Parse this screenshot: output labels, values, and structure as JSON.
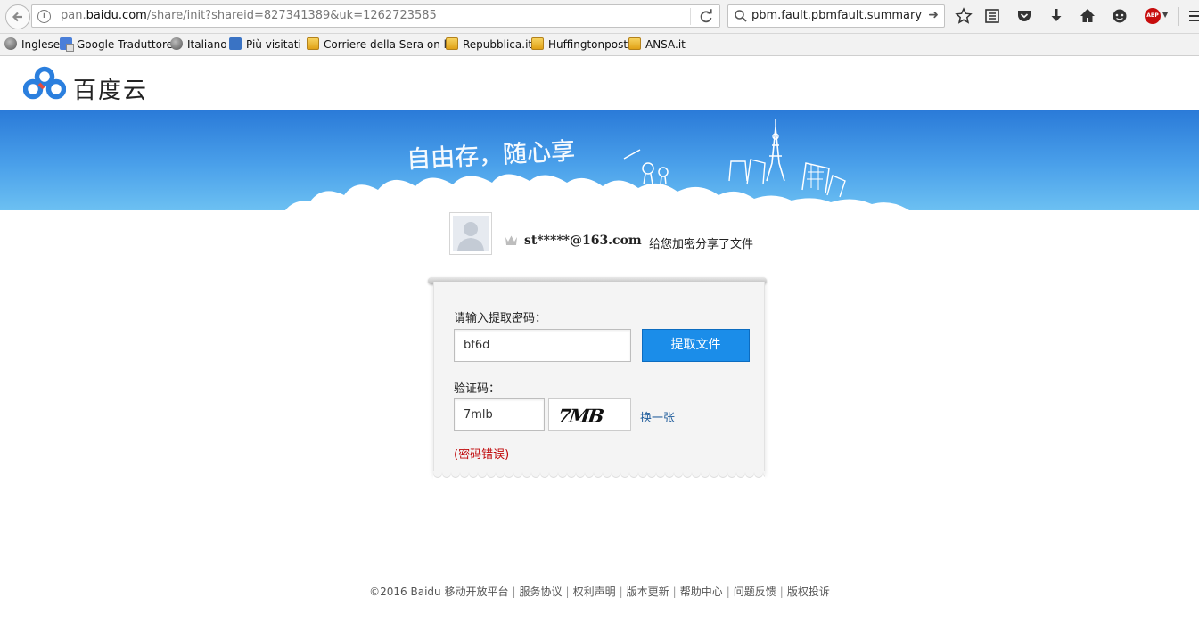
{
  "browser": {
    "url_prefix": "pan.",
    "url_domain": "baidu.com",
    "url_path": "/share/init?shareid=827341389&uk=1262723585",
    "search_text": "pbm.fault.pbmfault.summary",
    "addon_label": "ABP"
  },
  "bookmarks": [
    {
      "label": "Inglese",
      "icon": "globe-icon"
    },
    {
      "label": "Google Traduttore",
      "icon": "google-translate-icon"
    },
    {
      "label": "Italiano",
      "icon": "globe-icon"
    },
    {
      "label": "Più visitati",
      "icon": "most-visited-icon"
    },
    {
      "label": "Corriere della Sera on l...",
      "icon": "rss-feed-icon"
    },
    {
      "label": "Repubblica.it",
      "icon": "rss-feed-icon"
    },
    {
      "label": "Huffingtonpost",
      "icon": "rss-feed-icon"
    },
    {
      "label": "ANSA.it",
      "icon": "rss-feed-icon"
    }
  ],
  "header": {
    "logo_text": "百度云"
  },
  "banner": {
    "slogan": "自由存，随心享"
  },
  "share": {
    "user_name": "st*****@163.com",
    "message": "给您加密分享了文件"
  },
  "form": {
    "password_label": "请输入提取密码：",
    "password_value": "bf6d",
    "extract_button": "提取文件",
    "vcode_label": "验证码：",
    "vcode_value": "7mlb",
    "captcha_text": "7MB",
    "refresh_link": "换一张",
    "error": "(密码错误)"
  },
  "footer": {
    "copyright": "©2016 Baidu",
    "links": [
      "移动开放平台",
      "服务协议",
      "权利声明",
      "版本更新",
      "帮助中心",
      "问题反馈",
      "版权投诉"
    ]
  },
  "colors": {
    "accent": "#1b8de9",
    "error": "#c0080a",
    "link": "#1f5c9b",
    "banner_top": "#2a7ad8",
    "banner_bottom": "#6cc0f2"
  }
}
